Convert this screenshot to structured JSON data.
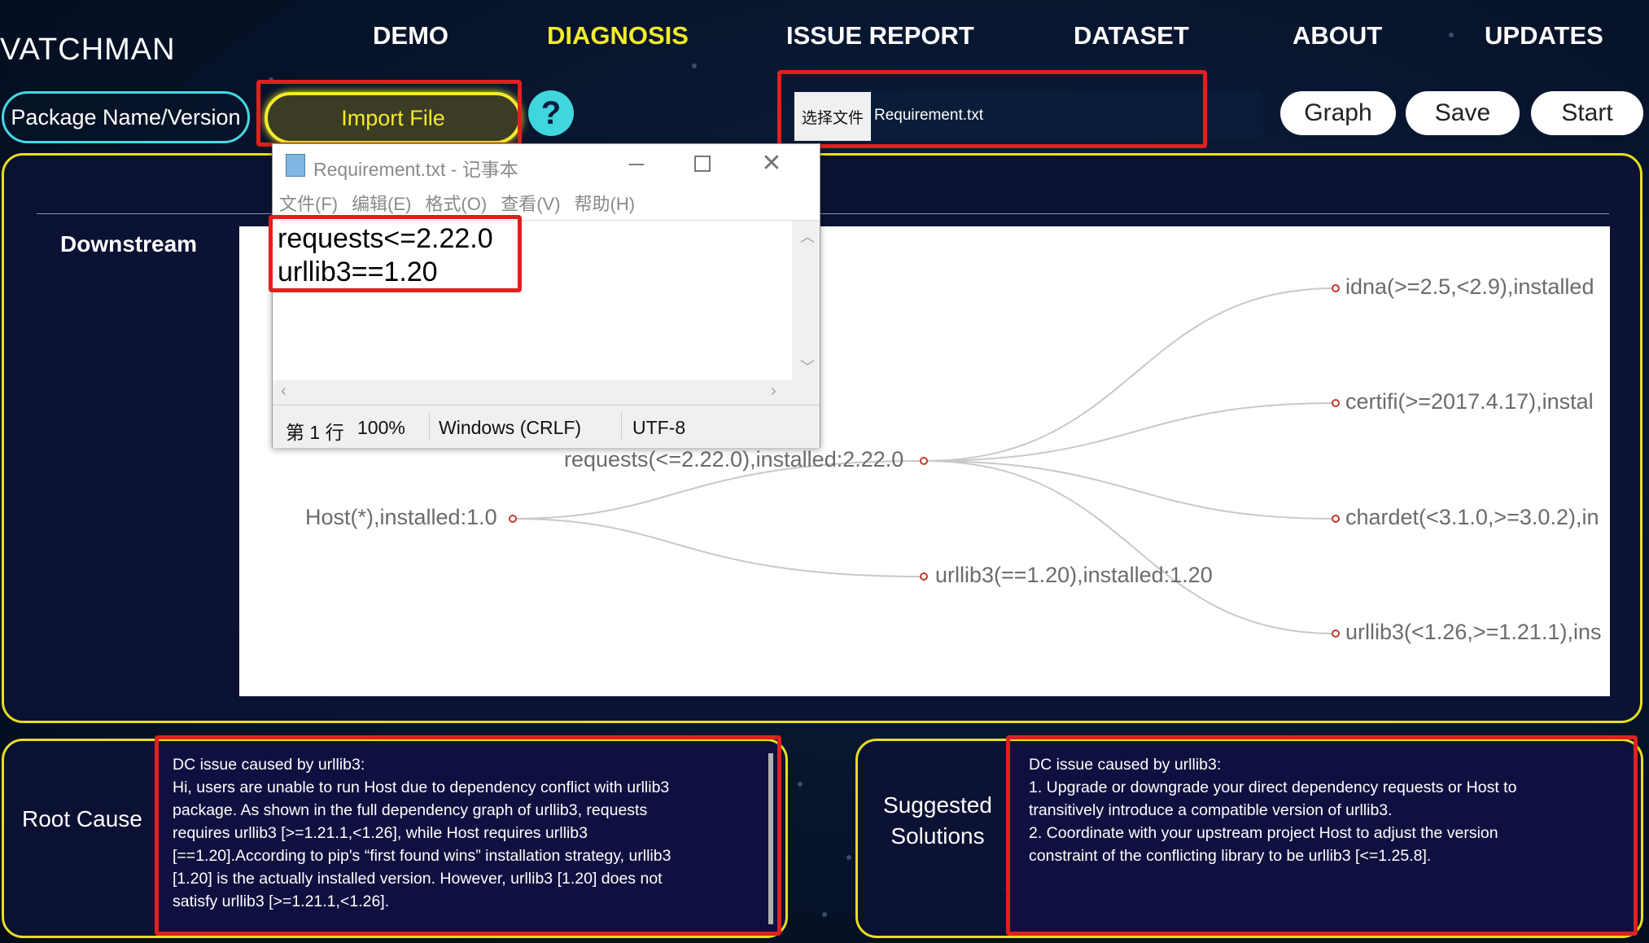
{
  "header": {
    "logo": "VATCHMAN",
    "nav": [
      "DEMO",
      "DIAGNOSIS",
      "ISSUE REPORT",
      "DATASET",
      "ABOUT",
      "UPDATES"
    ],
    "active_nav": "DIAGNOSIS"
  },
  "toolbar": {
    "package_label": "Package Name/Version",
    "import_label": "Import File",
    "help_glyph": "?",
    "choose_file_label": "选择文件",
    "file_name": "Requirement.txt",
    "graph_label": "Graph",
    "save_label": "Save",
    "start_label": "Start"
  },
  "notepad": {
    "title": "Requirement.txt - 记事本",
    "menu": [
      "文件(F)",
      "编辑(E)",
      "格式(O)",
      "查看(V)",
      "帮助(H)"
    ],
    "lines": [
      "requests<=2.22.0",
      "urllib3==1.20"
    ],
    "status": [
      "第 1 行",
      "100%",
      "Windows (CRLF)",
      "UTF-8"
    ]
  },
  "graph": {
    "section_label": "Downstream",
    "nodes": {
      "host": "Host(*),installed:1.0",
      "requests": "requests(<=2.22.0),installed:2.22.0",
      "urllib3_direct": "urllib3(==1.20),installed:1.20",
      "idna": "idna(>=2.5,<2.9),installed",
      "certifi": "certifi(>=2017.4.17),instal",
      "chardet": "chardet(<3.1.0,>=3.0.2),in",
      "urllib3_trans": "urllib3(<1.26,>=1.21.1),ins"
    }
  },
  "root_cause": {
    "label": "Root Cause",
    "lines": [
      "DC issue caused by urllib3:",
      "Hi, users are unable to run Host due to dependency conflict with urllib3",
      "package. As shown in the full dependency graph of urllib3, requests",
      "requires urllib3 [>=1.21.1,<1.26], while Host requires urllib3",
      "[==1.20].According to pip's  “first found wins”  installation strategy, urllib3",
      "[1.20] is the actually installed version. However, urllib3 [1.20] does not",
      "satisfy urllib3 [>=1.21.1,<1.26]."
    ]
  },
  "solutions": {
    "label_line1": "Suggested",
    "label_line2": "Solutions",
    "lines": [
      "DC issue caused by urllib3:",
      "1. Upgrade or downgrade your direct dependency requests or Host to",
      "transitively introduce a compatible version of urllib3.",
      "2. Coordinate with your upstream project Host to adjust the version",
      "constraint of the conflicting library to be urllib3 [<=1.25.8]."
    ]
  },
  "colors": {
    "accent_yellow": "#f3eb2b",
    "accent_cyan": "#43d9e6",
    "highlight_red": "#e0201f",
    "panel_bg": "#0c1234"
  }
}
